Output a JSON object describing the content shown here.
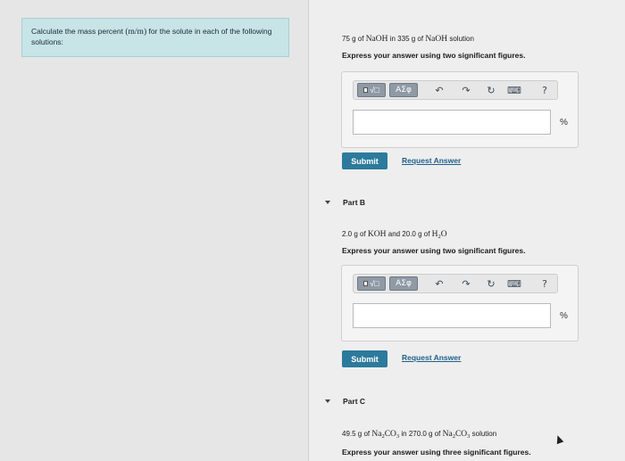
{
  "question": {
    "prefix": "Calculate the mass percent ",
    "math": "(m/m)",
    "suffix": " for the solute in each of the following solutions:"
  },
  "toolbar": {
    "template_icon": "template-icon",
    "template_label": "√□",
    "greek_label": "ΑΣφ",
    "undo_icon": "undo-icon",
    "redo_icon": "redo-icon",
    "reset_icon": "reset-icon",
    "keyboard_icon": "keyboard-icon",
    "help_label": "?"
  },
  "partA": {
    "problem_prefix": "75 g of ",
    "problem_solute": "NaOH",
    "problem_mid": " in 335 g of ",
    "problem_solution": "NaOH",
    "problem_suffix": " solution",
    "instruction": "Express your answer using two significant figures.",
    "input_value": "",
    "unit": "%",
    "submit_label": "Submit",
    "request_label": "Request Answer"
  },
  "partB": {
    "heading": "Part B",
    "problem_prefix": "2.0 g of ",
    "problem_solute": "KOH",
    "problem_mid": " and 20.0 g of ",
    "problem_solvent": "H",
    "problem_solvent_sub": "2",
    "problem_solvent_end": "O",
    "instruction": "Express your answer using two significant figures.",
    "input_value": "",
    "unit": "%",
    "submit_label": "Submit",
    "request_label": "Request Answer"
  },
  "partC": {
    "heading": "Part C",
    "problem_prefix": "49.5 g of ",
    "solute_a": "Na",
    "solute_sub1": "2",
    "solute_b": "CO",
    "solute_sub2": "3",
    "problem_mid": " in 270.0 g of ",
    "solution_a": "Na",
    "solution_sub1": "2",
    "solution_b": "CO",
    "solution_sub2": "3",
    "problem_suffix": " solution",
    "instruction": "Express your answer using three significant figures."
  }
}
